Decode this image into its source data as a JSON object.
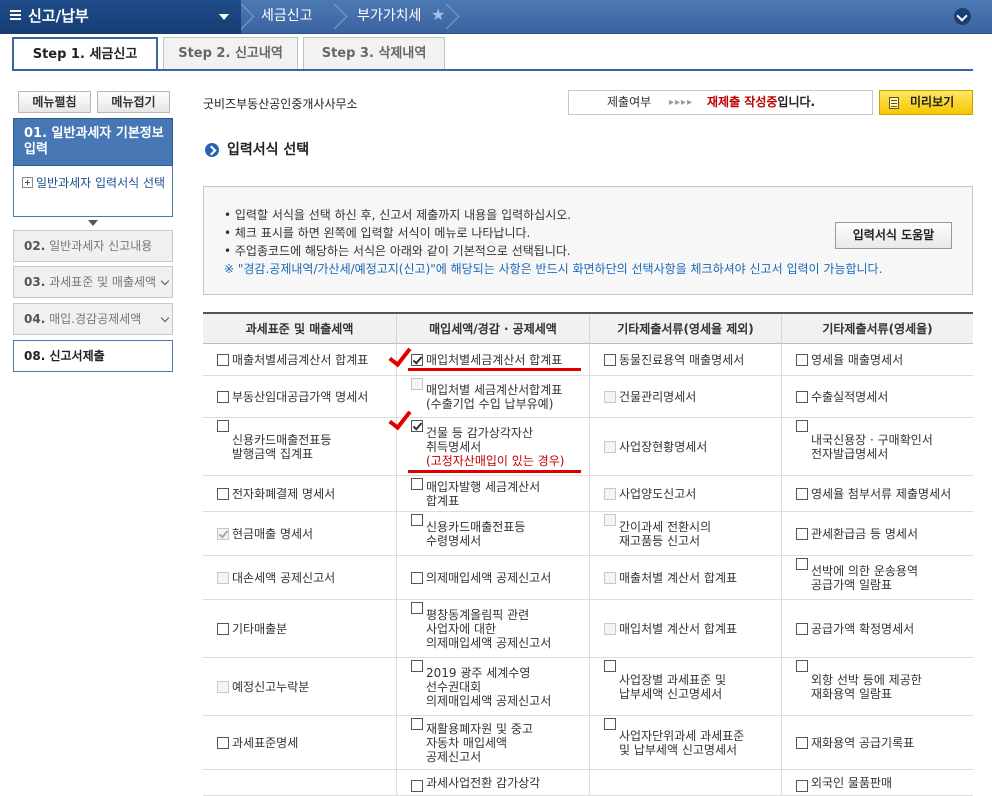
{
  "topbar": {
    "menu_title": "신고/납부",
    "breadcrumb": [
      "세금신고",
      "부가가치세"
    ]
  },
  "tabs": [
    "Step 1. 세금신고",
    "Step 2. 신고내역",
    "Step 3. 삭제내역"
  ],
  "sidebar": {
    "expand_all": "메뉴펼침",
    "collapse_all": "메뉴접기",
    "current_section": "01. 일반과세자 기본정보 입력",
    "sub_item": "일반과세자 입력서식 선택",
    "items": [
      {
        "num": "02.",
        "label": "일반과세자 신고내용"
      },
      {
        "num": "03.",
        "label": "과세표준 및 매출세액"
      },
      {
        "num": "04.",
        "label": "매입.경감공제세액"
      },
      {
        "num": "08.",
        "label": "신고서제출"
      }
    ]
  },
  "company_name": "굿비즈부동산공인중개사사무소",
  "status": {
    "label": "제출여부",
    "arrows": "▸▸▸▸",
    "value_red": "재제출 작성중",
    "value_suffix": "입니다."
  },
  "preview_button": "미리보기",
  "section_title": "입력서식 선택",
  "info": {
    "lines": [
      "• 입력할 서식을 선택 하신 후, 신고서 제출까지 내용을 입력하십시오.",
      "• 체크 표시를 하면 왼쪽에 입력할 서식이 메뉴로 나타납니다.",
      "• 주업종코드에 해당하는 서식은 아래와 같이 기본적으로 선택됩니다."
    ],
    "note": "※ \"경감.공제내역/가산세/예정고지(신고)\"에 해당되는 사항은 반드시 화면하단의 선택사항을 체크하셔야 신고서 입력이 가능합니다.",
    "help_button": "입력서식 도움말"
  },
  "table": {
    "headers": [
      "과세표준 및 매출세액",
      "매입세액/경감 · 공제세액",
      "기타제출서류(영세율 제외)",
      "기타제출서류(영세율)"
    ],
    "rows": [
      {
        "c": [
          {
            "t": [
              "매출처별세금계산서 합계표"
            ],
            "s": "off"
          },
          {
            "t": [
              "매입처별세금계산서 합계표"
            ],
            "s": "on"
          },
          {
            "t": [
              "동물진료용역 매출명세서"
            ],
            "s": "off"
          },
          {
            "t": [
              "영세율 매출명세서"
            ],
            "s": "off"
          }
        ]
      },
      {
        "c": [
          {
            "t": [
              "부동산임대공급가액 명세서"
            ],
            "s": "off"
          },
          {
            "t": [
              "매입처별 세금계산서합계표",
              "(수출기업 수입 납부유예)"
            ],
            "s": "dis"
          },
          {
            "t": [
              "건물관리명세서"
            ],
            "s": "dis"
          },
          {
            "t": [
              "수출실적명세서"
            ],
            "s": "off"
          }
        ]
      },
      {
        "c": [
          {
            "t": [
              "신용카드매출전표등",
              "발행금액 집계표"
            ],
            "s": "off"
          },
          {
            "t": [
              "건물 등 감가상각자산",
              "취득명세서"
            ],
            "red": "(고정자산매입이 있는 경우)",
            "s": "on"
          },
          {
            "t": [
              "사업장현황명세서"
            ],
            "s": "dis"
          },
          {
            "t": [
              "내국신용장 · 구매확인서",
              "전자발급명세서"
            ],
            "s": "off"
          }
        ]
      },
      {
        "c": [
          {
            "t": [
              "전자화폐결제 명세서"
            ],
            "s": "off"
          },
          {
            "t": [
              "매입자발행 세금계산서",
              "합계표"
            ],
            "s": "off"
          },
          {
            "t": [
              "사업양도신고서"
            ],
            "s": "dis"
          },
          {
            "t": [
              "영세율 첨부서류 제출명세서"
            ],
            "s": "off"
          }
        ]
      },
      {
        "c": [
          {
            "t": [
              "현금매출 명세서"
            ],
            "s": "ondis"
          },
          {
            "t": [
              "신용카드매출전표등",
              "수령명세서"
            ],
            "s": "off"
          },
          {
            "t": [
              "간이과세 전환시의",
              "재고품등 신고서"
            ],
            "s": "dis"
          },
          {
            "t": [
              "관세환급금 등 명세서"
            ],
            "s": "off"
          }
        ]
      },
      {
        "c": [
          {
            "t": [
              "대손세액 공제신고서"
            ],
            "s": "dis"
          },
          {
            "t": [
              "의제매입세액 공제신고서"
            ],
            "s": "off"
          },
          {
            "t": [
              "매출처별 계산서 합계표"
            ],
            "s": "dis"
          },
          {
            "t": [
              "선박에 의한 운송용역",
              "공급가액 일람표"
            ],
            "s": "off"
          }
        ]
      },
      {
        "c": [
          {
            "t": [
              "기타매출분"
            ],
            "s": "off"
          },
          {
            "t": [
              "평창동계올림픽 관련",
              "사업자에 대한",
              "의제매입세액 공제신고서"
            ],
            "s": "off"
          },
          {
            "t": [
              "매입처별 계산서 합계표"
            ],
            "s": "dis"
          },
          {
            "t": [
              "공급가액 확정명세서"
            ],
            "s": "off"
          }
        ]
      },
      {
        "c": [
          {
            "t": [
              "예정신고누락분"
            ],
            "s": "dis"
          },
          {
            "t": [
              "2019 광주 세계수영",
              "선수권대회",
              "의제매입세액 공제신고서"
            ],
            "s": "off"
          },
          {
            "t": [
              "사업장별 과세표준 및",
              "납부세액 신고명세서"
            ],
            "s": "off"
          },
          {
            "t": [
              "외항 선박 등에 제공한",
              "재화용역 일람표"
            ],
            "s": "off"
          }
        ]
      },
      {
        "c": [
          {
            "t": [
              "과세표준명세"
            ],
            "s": "off"
          },
          {
            "t": [
              "재활용폐자원 및 중고",
              "자동차 매입세액",
              "공제신고서"
            ],
            "s": "off"
          },
          {
            "t": [
              "사업자단위과세 과세표준",
              "및 납부세액 신고명세서"
            ],
            "s": "off"
          },
          {
            "t": [
              "재화용역 공급기록표"
            ],
            "s": "off"
          }
        ]
      },
      {
        "c": [
          {
            "t": [
              ""
            ],
            "s": "none"
          },
          {
            "t": [
              "과세사업전환 감가상각"
            ],
            "s": "off"
          },
          {
            "t": [
              ""
            ],
            "s": "none"
          },
          {
            "t": [
              "외국인 물품판매"
            ],
            "s": "off"
          }
        ]
      }
    ]
  }
}
